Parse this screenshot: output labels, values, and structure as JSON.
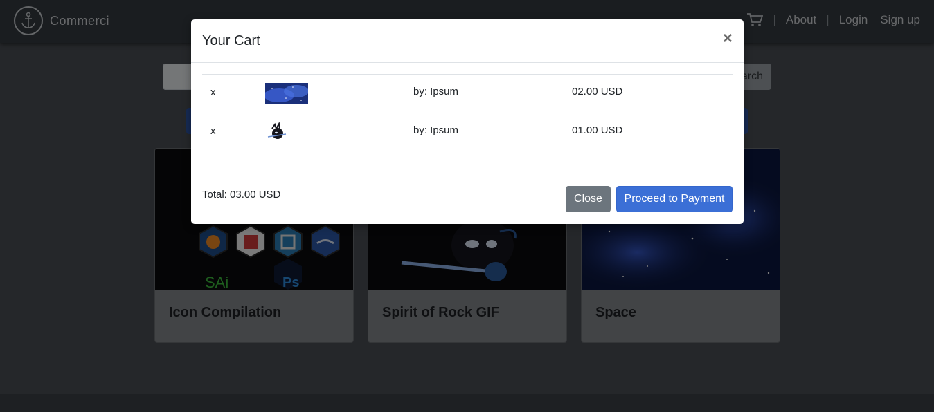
{
  "navbar": {
    "brand": "Commerci",
    "about": "About",
    "login": "Login",
    "signup": "Sign up",
    "separator": "|"
  },
  "search": {
    "button_label": "Search"
  },
  "cards": [
    {
      "title": "Icon Compilation"
    },
    {
      "title": "Spirit of Rock GIF"
    },
    {
      "title": "Space"
    }
  ],
  "cart_modal": {
    "title": "Your Cart",
    "close_glyph": "×",
    "items": [
      {
        "remove": "x",
        "thumbnail": "space-thumbnail",
        "seller": "by: Ipsum",
        "price": "02.00 USD"
      },
      {
        "remove": "x",
        "thumbnail": "spirit-of-rock-thumbnail",
        "seller": "by: Ipsum",
        "price": "01.00 USD"
      }
    ],
    "total": "Total: 03.00 USD",
    "close_label": "Close",
    "payment_label": "Proceed to Payment"
  },
  "colors": {
    "navbar": "#343a40",
    "primary": "#3b6fd6",
    "secondary": "#6c757d"
  }
}
